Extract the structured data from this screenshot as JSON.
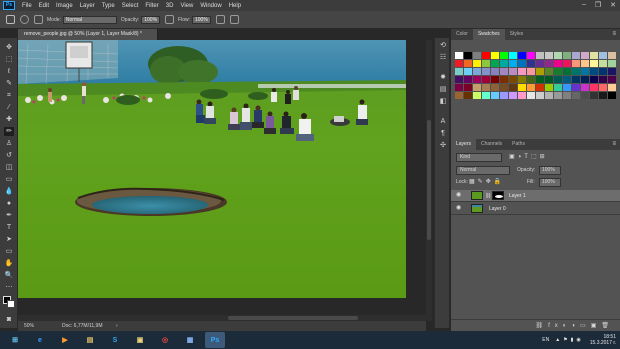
{
  "menubar": {
    "logo": "Ps",
    "items": [
      "File",
      "Edit",
      "Image",
      "Layer",
      "Type",
      "Select",
      "Filter",
      "3D",
      "View",
      "Window",
      "Help"
    ]
  },
  "options": {
    "mode_label": "Mode:",
    "mode_value": "Normal",
    "opacity_label": "Opacity:",
    "opacity_value": "100%",
    "flow_label": "Flow:",
    "flow_value": "100%"
  },
  "document": {
    "tab_title": "remove_people.jpg @ 50% (Layer 1, Layer Mask/8) *",
    "zoom": "50%",
    "doc_info": "Doc: 6,77M/11,9M"
  },
  "swatch_panel": {
    "tabs": [
      "Color",
      "Swatches",
      "Styles"
    ],
    "active_tab": "Swatches",
    "colors": [
      "#ffffff",
      "#000000",
      "#7f7f7f",
      "#ff0000",
      "#ffff00",
      "#00ff00",
      "#00ffff",
      "#0000ff",
      "#ff00ff",
      "#c0c0c0",
      "#c8c8c8",
      "#b0d8b0",
      "#80b080",
      "#a8a8d0",
      "#d0a8c8",
      "#e0e0a0",
      "#a0c0e0",
      "#d8c0a0",
      "#ed1c24",
      "#f26522",
      "#fff200",
      "#8dc63f",
      "#00a651",
      "#00a99d",
      "#00aeef",
      "#0072bc",
      "#2e3192",
      "#662d91",
      "#92278f",
      "#ec008c",
      "#ed145b",
      "#f7977a",
      "#fdc68a",
      "#fff79a",
      "#c4df9b",
      "#a3d39c",
      "#7accc8",
      "#6dcff6",
      "#7da7d9",
      "#8393ca",
      "#8781bd",
      "#a187be",
      "#bd8cbf",
      "#f49ac2",
      "#f6989d",
      "#aba000",
      "#598527",
      "#1a7b30",
      "#007236",
      "#00746b",
      "#0076a3",
      "#004b80",
      "#003471",
      "#1b1464",
      "#440e62",
      "#630460",
      "#9e005d",
      "#9e0039",
      "#790000",
      "#7b2e00",
      "#7d4900",
      "#827b00",
      "#406618",
      "#005e20",
      "#005826",
      "#005952",
      "#005b7f",
      "#003663",
      "#002157",
      "#0d004c",
      "#32004b",
      "#4b0049",
      "#7b0046",
      "#7a0026",
      "#c69c6d",
      "#a67c52",
      "#8c6239",
      "#754c24",
      "#603913",
      "#ffdd00",
      "#ff9933",
      "#cc3300",
      "#99cc00",
      "#33cc99",
      "#3399ff",
      "#6633cc",
      "#cc33cc",
      "#ff3366",
      "#ff6666",
      "#ffcc99",
      "#996633",
      "#663300",
      "#ccff66",
      "#66ffcc",
      "#66ccff",
      "#9999ff",
      "#cc99ff",
      "#ff99cc",
      "#e6e6e6",
      "#cccccc",
      "#b3b3b3",
      "#999999",
      "#808080",
      "#666666",
      "#4d4d4d",
      "#333333",
      "#1a1a1a",
      "#000000"
    ]
  },
  "layers_panel": {
    "tabs": [
      "Layers",
      "Channels",
      "Paths"
    ],
    "active_tab": "Layers",
    "filter_label": "Kind",
    "blend_mode": "Normal",
    "opacity_label": "Opacity:",
    "opacity_value": "100%",
    "lock_label": "Lock:",
    "fill_label": "Fill:",
    "fill_value": "100%",
    "layers": [
      {
        "name": "Layer 1",
        "selected": true
      },
      {
        "name": "Layer 0",
        "selected": false
      }
    ]
  },
  "taskbar": {
    "apps": [
      "start-icon",
      "ie-icon",
      "media-icon",
      "folder-icon",
      "skype-icon",
      "viewer-icon",
      "chrome-icon",
      "explorer-icon",
      "photoshop-icon"
    ],
    "lang": "EN",
    "time": "18:51",
    "date": "15.3.2017 г."
  }
}
